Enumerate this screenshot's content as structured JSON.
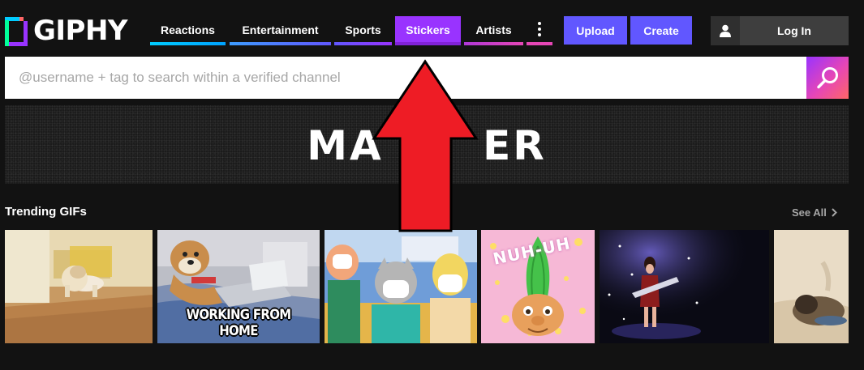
{
  "brand": {
    "name": "GIPHY"
  },
  "nav": {
    "items": [
      {
        "label": "Reactions",
        "color": "#00ccff"
      },
      {
        "label": "Entertainment",
        "color": "#6157ff"
      },
      {
        "label": "Sports",
        "color": "#9933ff"
      },
      {
        "label": "Stickers",
        "color": "#9933ff",
        "active": true
      },
      {
        "label": "Artists",
        "color": "#e646b6"
      }
    ],
    "more_icon": "more-vertical-icon"
  },
  "actions": {
    "upload_label": "Upload",
    "create_label": "Create",
    "login_label": "Log In",
    "accent": "#6157ff"
  },
  "search": {
    "placeholder": "@username + tag to search within a verified channel",
    "icon": "search-icon"
  },
  "banner": {
    "text": "MA      ER"
  },
  "trending": {
    "title": "Trending GIFs",
    "see_all_label": "See All",
    "gifs": [
      {
        "icon": "corgi-puppy-gif"
      },
      {
        "icon": "dog-with-laptop-gif",
        "caption": "WORKING FROM HOME"
      },
      {
        "icon": "cartoon-masks-gif"
      },
      {
        "icon": "troll-doll-gif",
        "overlay_text": "NUH-UH"
      },
      {
        "icon": "singer-on-stage-gif"
      },
      {
        "icon": "dog-on-beach-gif"
      }
    ]
  },
  "annotation": {
    "icon": "red-up-arrow",
    "color": "#ee1c25"
  }
}
